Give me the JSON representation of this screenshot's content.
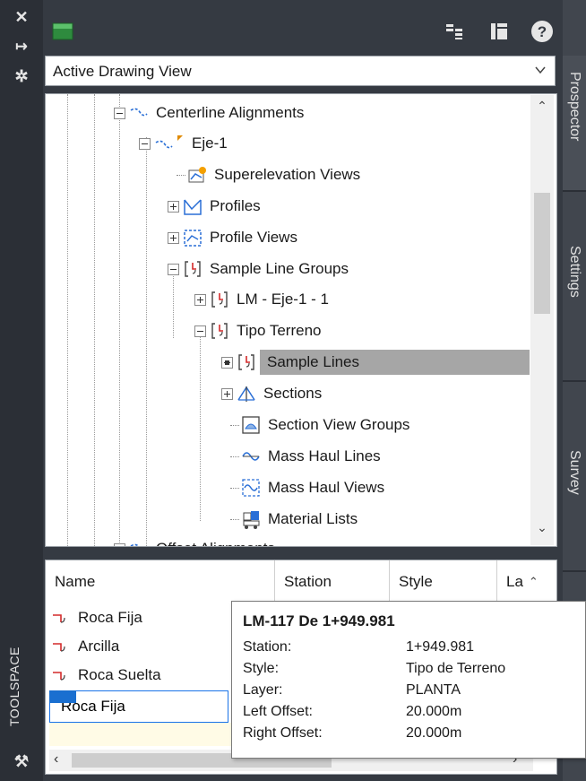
{
  "toolspace_label": "TOOLSPACE",
  "dropdown": {
    "value": "Active Drawing View"
  },
  "tabs": {
    "prospector": "Prospector",
    "settings": "Settings",
    "survey": "Survey"
  },
  "tree": {
    "centerline_alignments": "Centerline Alignments",
    "eje1": "Eje-1",
    "superelevation_views": "Superelevation Views",
    "profiles": "Profiles",
    "profile_views": "Profile Views",
    "sample_line_groups": "Sample Line Groups",
    "lm_eje": "LM - Eje-1 - 1",
    "tipo_terreno": "Tipo Terreno",
    "sample_lines": "Sample Lines",
    "sections": "Sections",
    "section_view_groups": "Section View Groups",
    "mass_haul_lines": "Mass Haul Lines",
    "mass_haul_views": "Mass Haul Views",
    "material_lists": "Material Lists",
    "offset_alignments": "Offset Alignments"
  },
  "table": {
    "headers": {
      "name": "Name",
      "station": "Station",
      "style": "Style",
      "layer": "La"
    },
    "rows": [
      "Roca Fija",
      "Arcilla",
      "Roca Suelta"
    ],
    "edit_value": "Roca Fija"
  },
  "tooltip": {
    "title": "LM-117 De 1+949.981",
    "station_label": "Station:",
    "station_value": "1+949.981",
    "style_label": "Style:",
    "style_value": "Tipo de Terreno",
    "layer_label": "Layer:",
    "layer_value": "PLANTA",
    "left_label": "Left Offset:",
    "left_value": "20.000m",
    "right_label": "Right Offset:",
    "right_value": "20.000m"
  },
  "icons": {
    "close": "close-icon",
    "pin": "pin-icon",
    "settings": "gear-icon",
    "toolspace": "tools-icon",
    "drawing": "drawing-icon",
    "panel_toggle": "panel-toggle-icon",
    "panel_view": "panel-view-icon",
    "help": "help-icon"
  },
  "colors": {
    "accent": "#1a6fd0",
    "selection": "#a6a6a6",
    "panel_bg": "#353a42"
  }
}
